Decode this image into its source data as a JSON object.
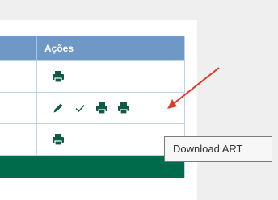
{
  "table": {
    "actions_header": "Ações",
    "rows": [
      {
        "icons": [
          "print-icon"
        ]
      },
      {
        "icons": [
          "pencil-icon",
          "check-icon",
          "print-icon",
          "print-icon"
        ]
      },
      {
        "icons": [
          "print-icon"
        ]
      }
    ]
  },
  "tooltip": {
    "text": "Download ART"
  },
  "colors": {
    "header_bg": "#6f98c6",
    "icon_green": "#0c5b47",
    "footer_green": "#006b4b",
    "annotation_red": "#e03a2f"
  }
}
